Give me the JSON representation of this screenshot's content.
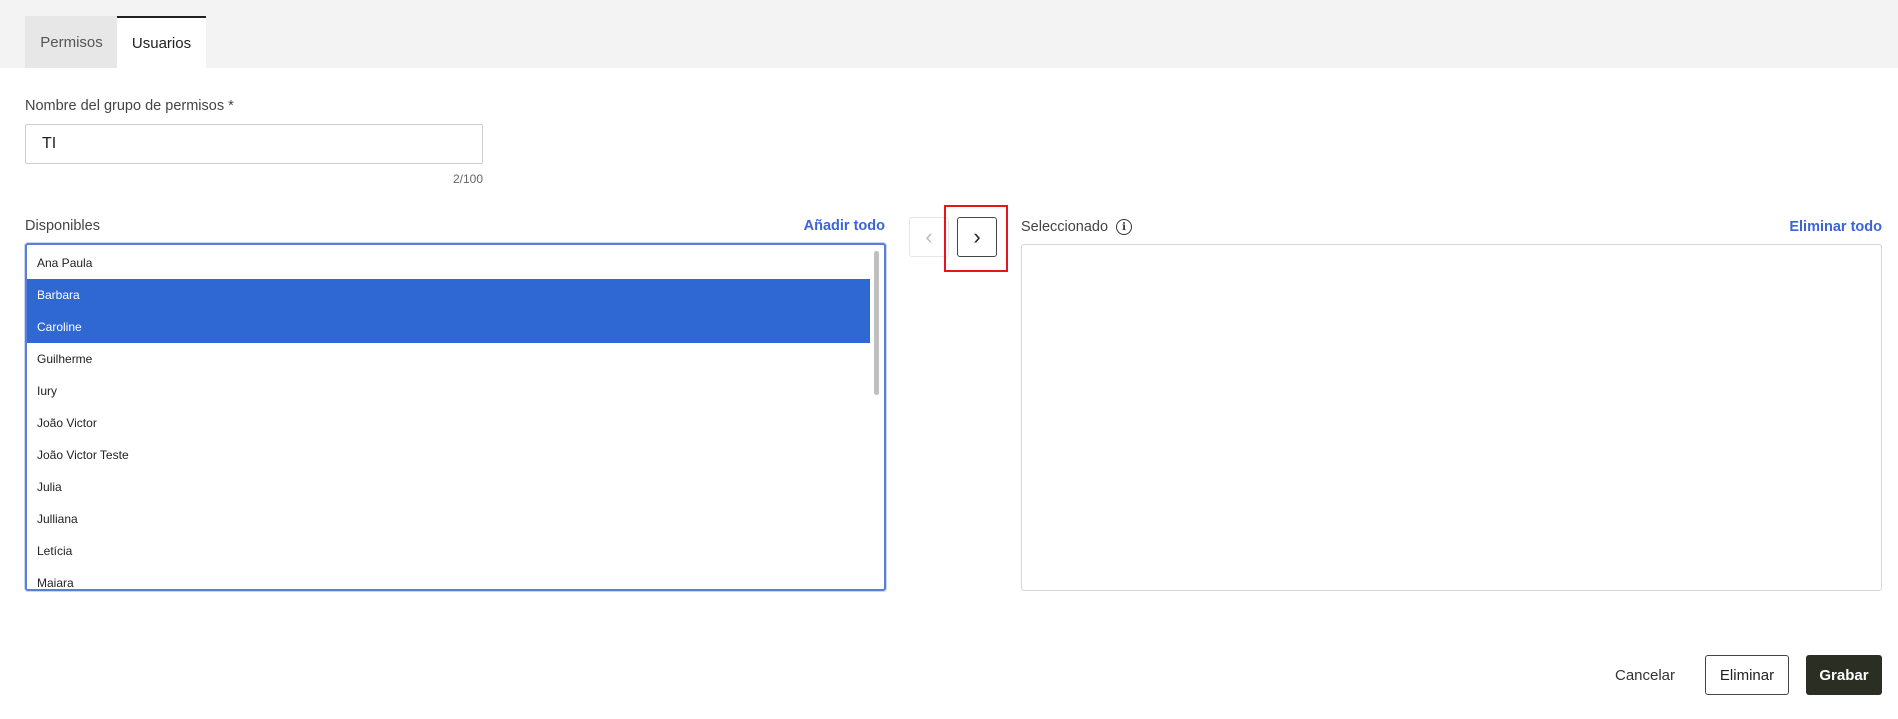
{
  "tabs": [
    {
      "label": "Permisos",
      "active": false
    },
    {
      "label": "Usuarios",
      "active": true
    }
  ],
  "group_name": {
    "label": "Nombre del grupo de permisos *",
    "value": "TI",
    "counter": "2/100"
  },
  "available": {
    "label": "Disponibles",
    "add_all": "Añadir todo",
    "items": [
      {
        "name": "Ana Paula",
        "selected": false
      },
      {
        "name": "Barbara",
        "selected": true
      },
      {
        "name": "Caroline",
        "selected": true
      },
      {
        "name": "Guilherme",
        "selected": false
      },
      {
        "name": "Iury",
        "selected": false
      },
      {
        "name": "João Victor",
        "selected": false
      },
      {
        "name": "João Victor Teste",
        "selected": false
      },
      {
        "name": "Julia",
        "selected": false
      },
      {
        "name": "Julliana",
        "selected": false
      },
      {
        "name": "Letícia",
        "selected": false
      },
      {
        "name": "Maiara",
        "selected": false
      }
    ]
  },
  "selected": {
    "label": "Seleccionado",
    "info_icon": "info-icon",
    "remove_all": "Eliminar todo",
    "items": []
  },
  "transfer": {
    "left_icon": "chevron-left-icon",
    "left_glyph": "‹",
    "right_icon": "chevron-right-icon",
    "right_glyph": "›"
  },
  "actions": {
    "cancel": "Cancelar",
    "delete": "Eliminar",
    "save": "Grabar"
  },
  "colors": {
    "accent": "#3a64d8",
    "selection": "#2f67d3",
    "primary_button": "#2b2f23",
    "highlight": "#e8161b"
  }
}
